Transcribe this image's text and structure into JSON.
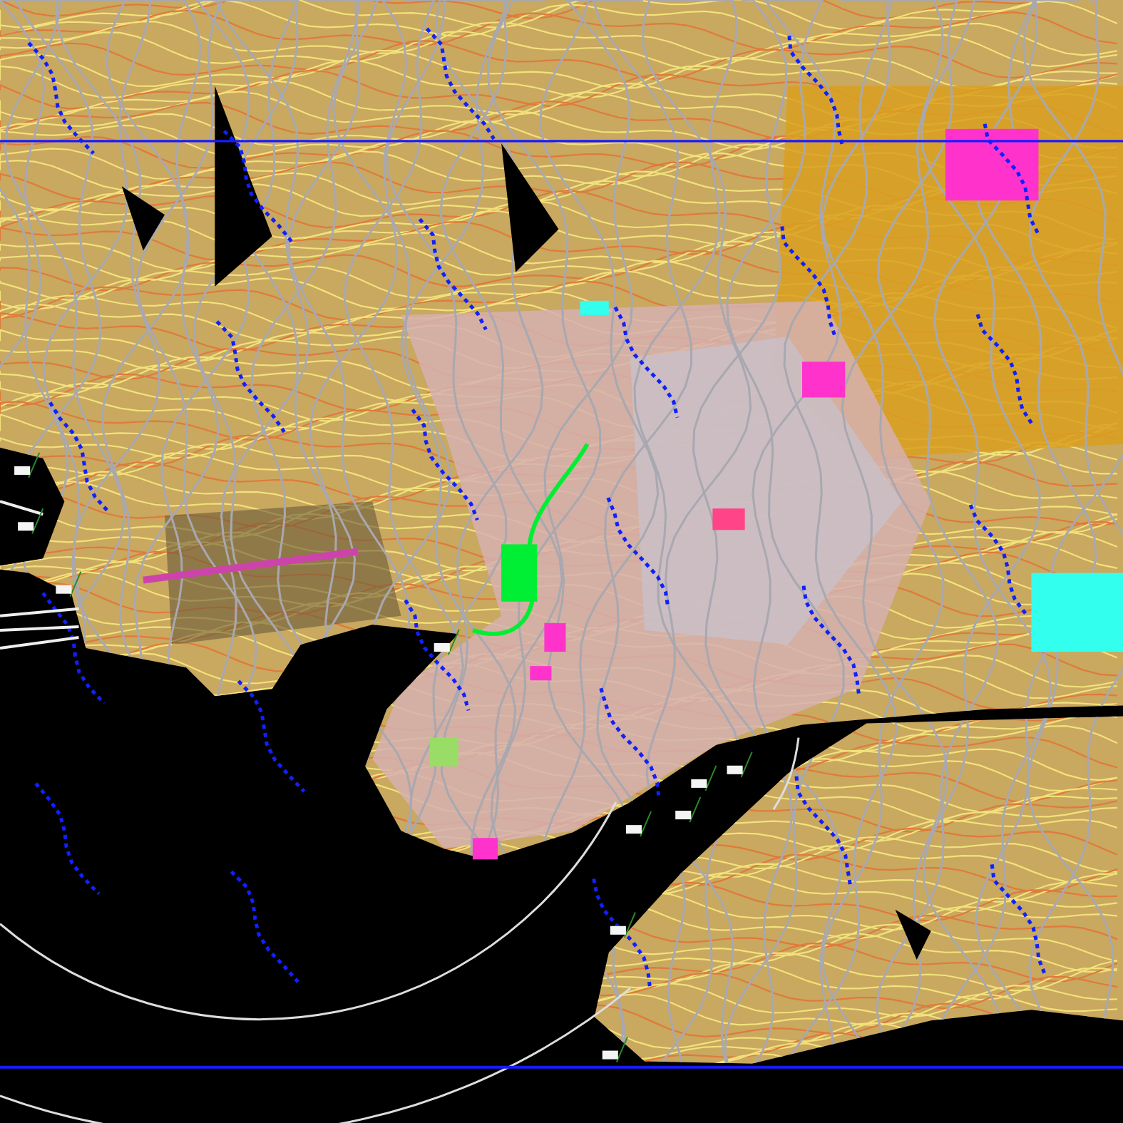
{
  "viewport": {
    "kind": "map-drawing"
  }
}
